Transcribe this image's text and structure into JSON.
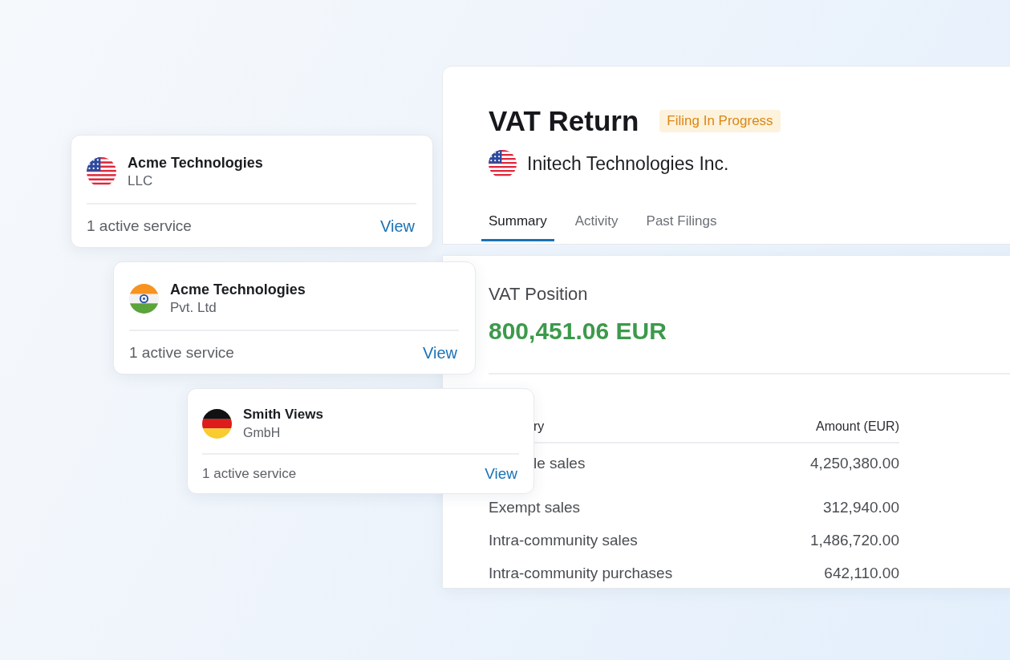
{
  "entity_cards": [
    {
      "name": "Acme Technologies",
      "suffix": "LLC",
      "services": "1 active service",
      "action": "View"
    },
    {
      "name": "Acme Technologies",
      "suffix": "Pvt. Ltd",
      "services": "1 active service",
      "action": "View"
    },
    {
      "name": "Smith Views",
      "suffix": "GmbH",
      "services": "1 active service",
      "action": "View"
    }
  ],
  "vat_return": {
    "title": "VAT Return",
    "status": "Filing In Progress",
    "company": "Initech Technologies Inc.",
    "tabs": [
      {
        "label": "Summary",
        "selected": true
      },
      {
        "label": "Activity",
        "selected": false
      },
      {
        "label": "Past Filings",
        "selected": false
      }
    ]
  },
  "vat_position": {
    "label": "VAT Position",
    "amount": "800,451.06 EUR",
    "table": {
      "columns": [
        {
          "label": "ry",
          "covered": true
        },
        {
          "label": "Amount (EUR)"
        }
      ],
      "rows": [
        {
          "category": "le sales",
          "covered": true,
          "amount": "4,250,380.00"
        },
        {
          "category": "Exempt sales",
          "amount": "312,940.00"
        },
        {
          "category": "Intra-community sales",
          "amount": "1,486,720.00"
        },
        {
          "category": "Intra-community purchases",
          "amount": "642,110.00"
        }
      ]
    }
  }
}
